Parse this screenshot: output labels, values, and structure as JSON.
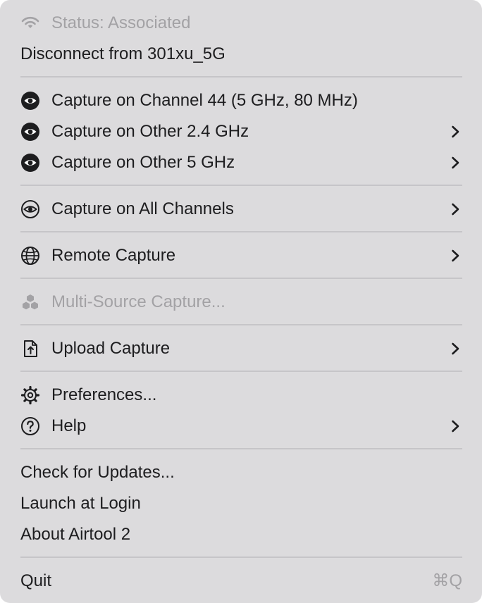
{
  "menu": {
    "status": "Status: Associated",
    "disconnect": "Disconnect from 301xu_5G",
    "capture_channel": "Capture on Channel 44 (5 GHz, 80 MHz)",
    "capture_other_24": "Capture on Other 2.4 GHz",
    "capture_other_5": "Capture on Other 5 GHz",
    "capture_all": "Capture on All Channels",
    "remote_capture": "Remote Capture",
    "multi_source": "Multi-Source Capture...",
    "upload_capture": "Upload Capture",
    "preferences": "Preferences...",
    "help": "Help",
    "check_updates": "Check for Updates...",
    "launch_login": "Launch at Login",
    "about": "About Airtool 2",
    "quit": "Quit",
    "quit_shortcut": "⌘Q"
  },
  "colors": {
    "menu_background": "#dcdbdd",
    "text": "#1d1d1f",
    "disabled_text": "#a3a2a5",
    "separator": "#c6c5c8"
  }
}
